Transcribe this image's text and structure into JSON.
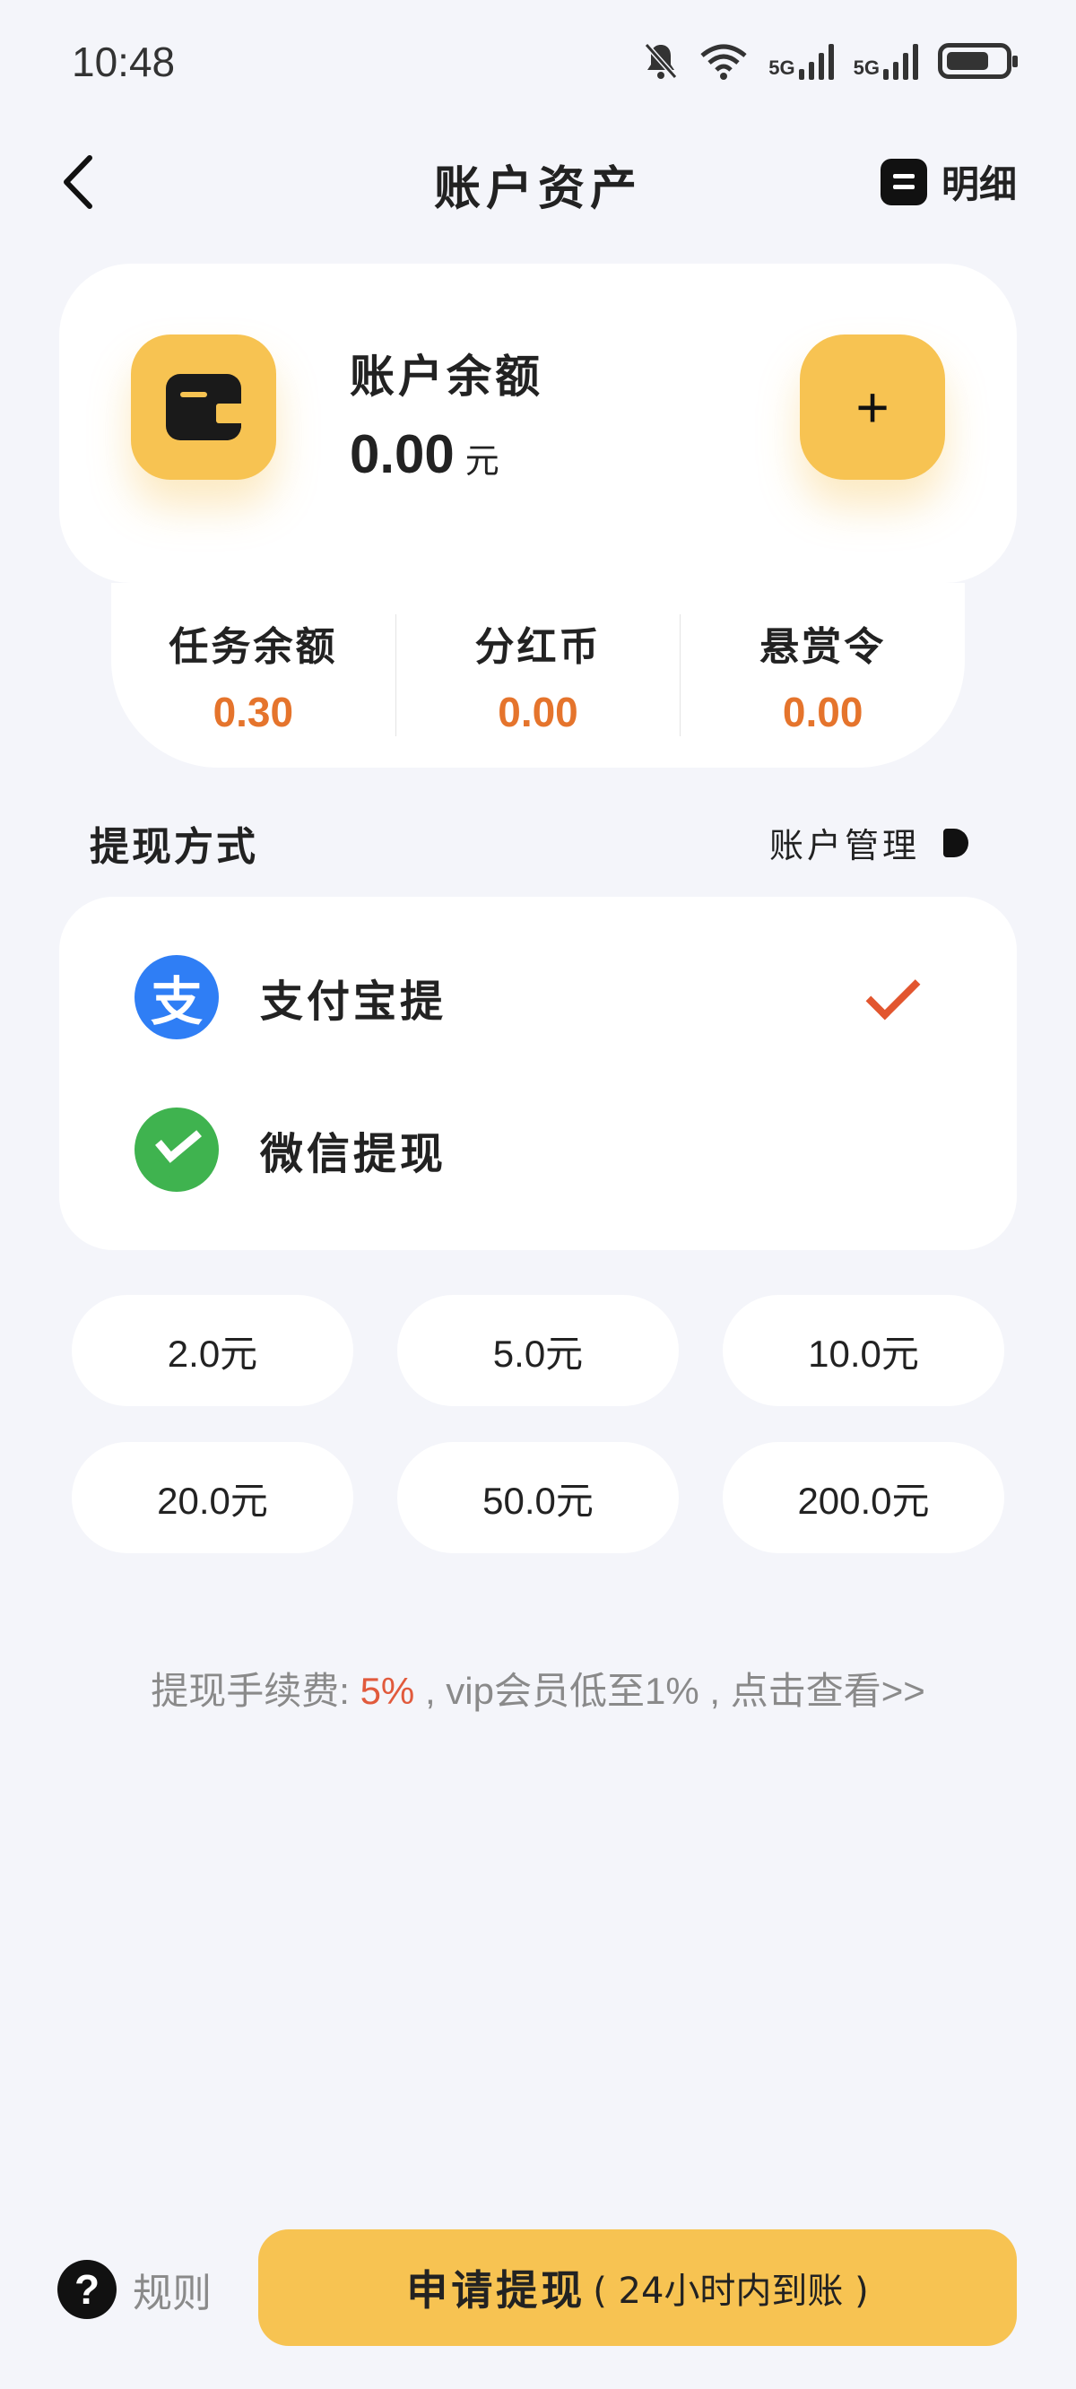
{
  "status_bar": {
    "time": "10:48",
    "net1": "5G",
    "net2": "5G"
  },
  "header": {
    "title": "账户资产",
    "detail_label": "明细"
  },
  "balance": {
    "label": "账户余额",
    "value": "0.00",
    "unit": "元",
    "add_symbol": "+"
  },
  "sub_balances": [
    {
      "label": "任务余额",
      "value": "0.30"
    },
    {
      "label": "分红币",
      "value": "0.00"
    },
    {
      "label": "悬赏令",
      "value": "0.00"
    }
  ],
  "withdraw": {
    "title": "提现方式",
    "manage_label": "账户管理",
    "methods": [
      {
        "label": "支付宝提",
        "icon_char": "支",
        "selected": true
      },
      {
        "label": "微信提现",
        "selected": false
      }
    ]
  },
  "amounts": [
    "2.0元",
    "5.0元",
    "10.0元",
    "20.0元",
    "50.0元",
    "200.0元"
  ],
  "fee_note": {
    "prefix": "提现手续费: ",
    "rate": "5%",
    "suffix": " , vip会员低至1% , 点击查看>>"
  },
  "footer": {
    "rules_icon": "?",
    "rules_label": "规则",
    "submit_main": "申请提现",
    "submit_sub": "( 24小时内到账 )"
  },
  "colors": {
    "accent": "#f7c352",
    "value_orange": "#e5742c",
    "check_red": "#e2562f",
    "alipay_blue": "#2f7ef5",
    "wechat_green": "#3fb34f"
  }
}
